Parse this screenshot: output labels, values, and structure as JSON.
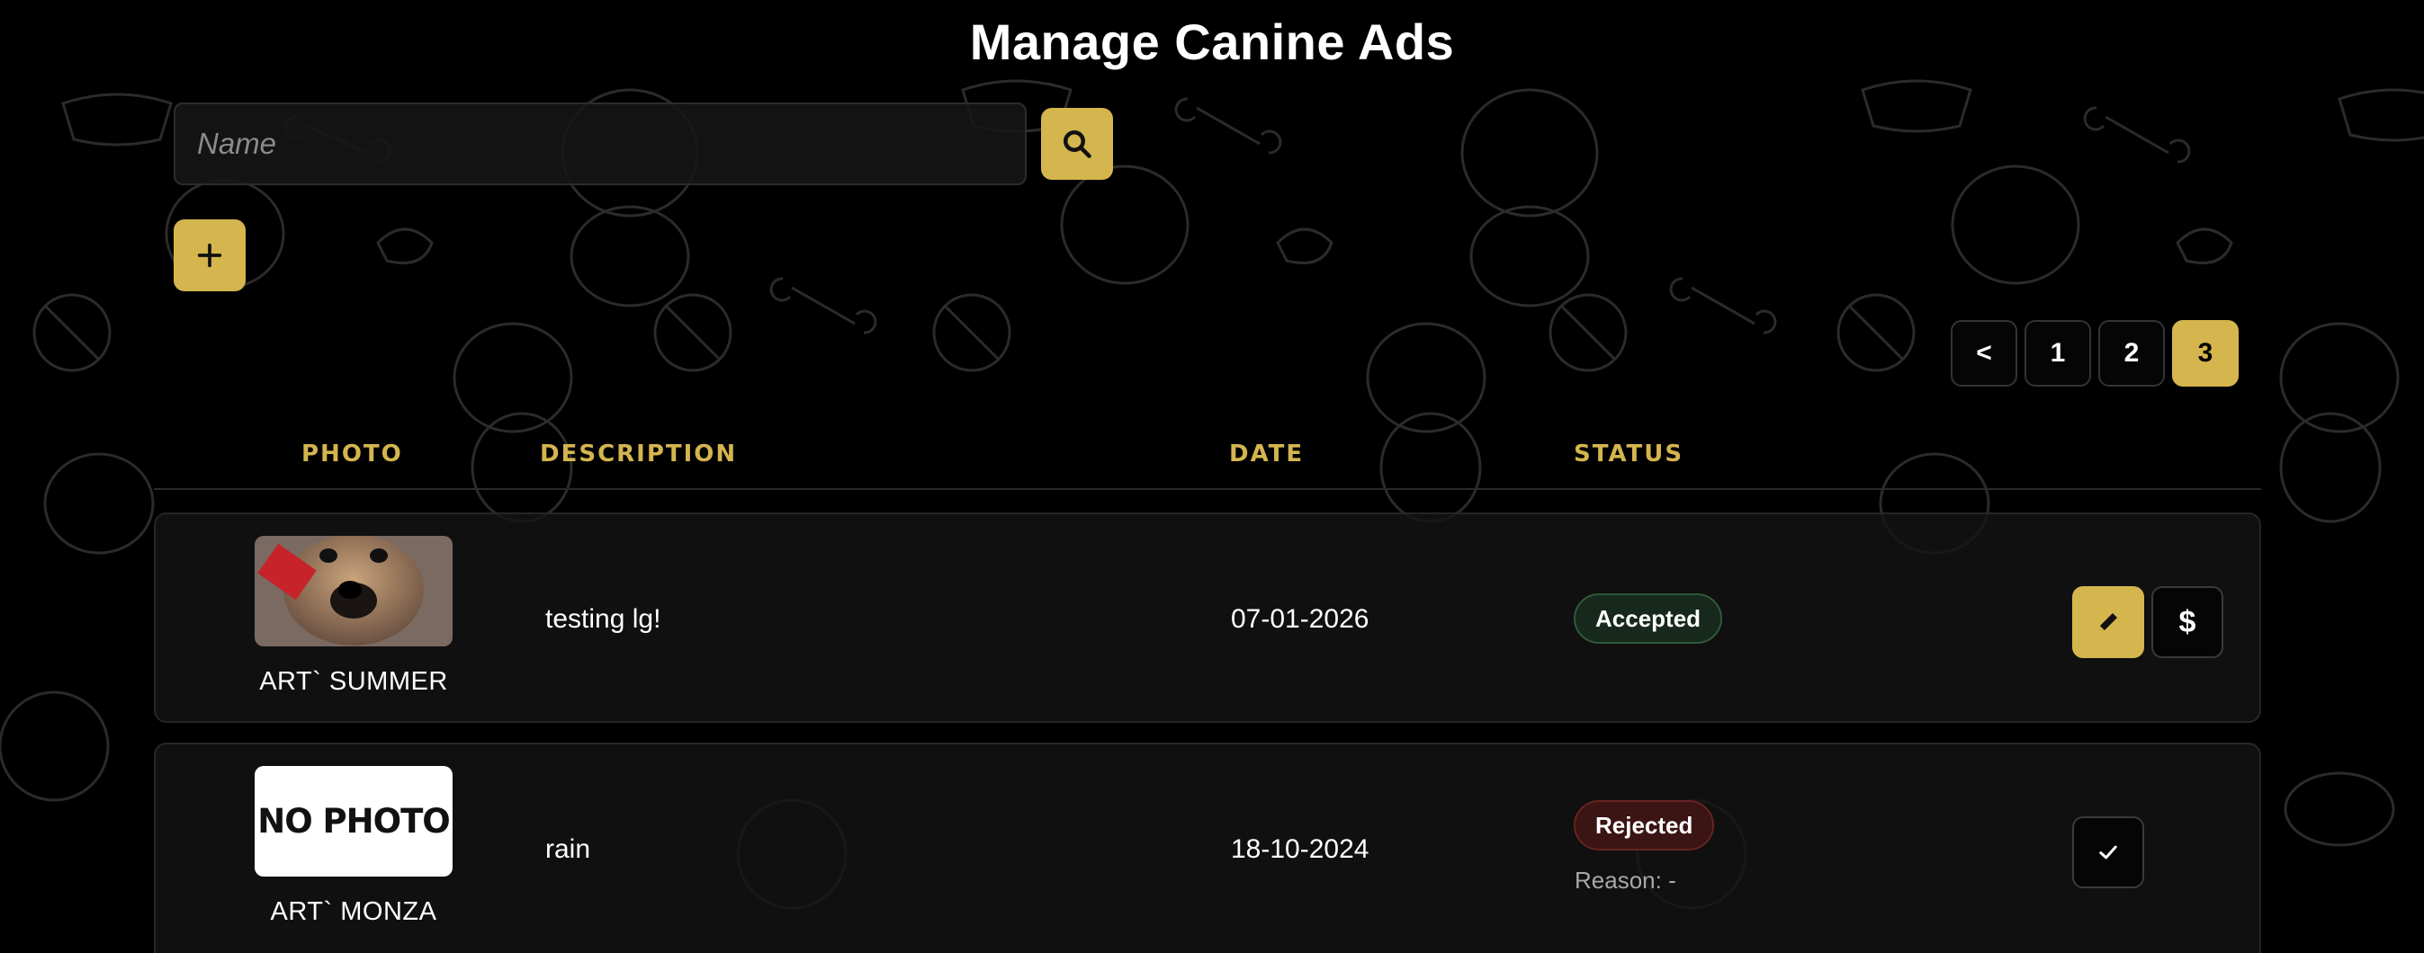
{
  "page": {
    "title": "Manage Canine Ads"
  },
  "search": {
    "placeholder": "Name"
  },
  "pagination": {
    "prev_label": "<",
    "pages": [
      "1",
      "2",
      "3"
    ],
    "active_page": "3"
  },
  "table": {
    "headers": {
      "photo": "PHOTO",
      "description": "DESCRIPTION",
      "date": "DATE",
      "status": "STATUS"
    },
    "rows": [
      {
        "photo": "dog-photo",
        "name": "ART` SUMMER",
        "description": "testing lg!",
        "date": "07-01-2026",
        "status": "Accepted",
        "actions": [
          "edit",
          "price"
        ],
        "price_label": "$"
      },
      {
        "photo": "no-photo",
        "photo_text": "NO PHOTO",
        "name": "ART` MONZA",
        "description": "rain",
        "date": "18-10-2024",
        "status": "Rejected",
        "reason": "Reason: -",
        "actions": [
          "approve"
        ]
      }
    ]
  },
  "colors": {
    "accent": "#d4b54e",
    "background": "#000000",
    "accepted": "#17291c",
    "rejected": "#3b1414"
  }
}
